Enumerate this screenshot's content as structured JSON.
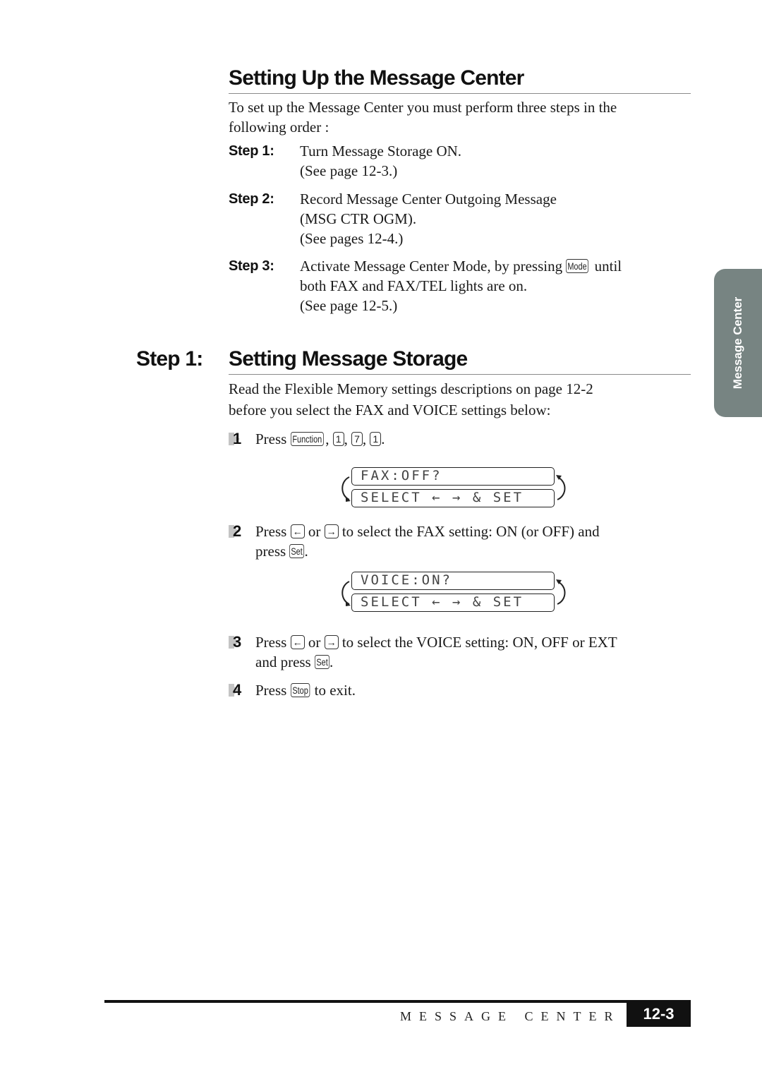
{
  "section1": {
    "title": "Setting Up the Message Center",
    "intro_line1": "To set up the Message Center you must perform three steps in the",
    "intro_line2": "following order :",
    "steps": [
      {
        "label": "Step 1:",
        "lines": [
          "Turn Message Storage ON.",
          "(See page 12-3.)"
        ]
      },
      {
        "label": "Step 2:",
        "lines": [
          "Record Message Center Outgoing Message",
          "(MSG CTR OGM).",
          "(See pages 12-4.)"
        ]
      },
      {
        "label": "Step 3:",
        "line1_before_key": "Activate Message Center Mode, by pressing",
        "key": "Mode",
        "line1_after_key": "until",
        "lines": [
          "both FAX and FAX/TEL lights are on.",
          "(See page 12-5.)"
        ]
      }
    ]
  },
  "section2": {
    "prefix": "Step 1:",
    "title": "Setting Message Storage",
    "intro_line1": "Read the Flexible Memory settings descriptions on page 12-2",
    "intro_line2": "before you select the FAX and VOICE settings below:",
    "items": [
      {
        "number": "1",
        "press": "Press",
        "keys": [
          "Function",
          "1",
          "7",
          "1"
        ],
        "sep": ",",
        "end": "."
      },
      {
        "number": "2",
        "press": "Press",
        "key_left": "←",
        "or": "or",
        "key_right": "→",
        "text": "to select the FAX setting:  ON (or OFF) and",
        "line2_before": "press",
        "key_set": "Set",
        "line2_after": "."
      },
      {
        "number": "3",
        "press": "Press",
        "key_left": "←",
        "or": "or",
        "key_right": "→",
        "text": "to select the VOICE setting:  ON, OFF or EXT",
        "line2_before": "and press",
        "key_set": "Set",
        "line2_after": "."
      },
      {
        "number": "4",
        "press": "Press",
        "key_stop": "Stop",
        "text": "to exit."
      }
    ],
    "lcd_fax": {
      "line1": "FAX:OFF?",
      "line2": "SELECT ← → & SET"
    },
    "lcd_voice": {
      "line1": "VOICE:ON?",
      "line2": "SELECT ← → & SET"
    }
  },
  "side_tab": {
    "label": "Message Center",
    "color": "#778482"
  },
  "footer": {
    "title": "MESSAGE CENTER",
    "page": "12-3"
  }
}
